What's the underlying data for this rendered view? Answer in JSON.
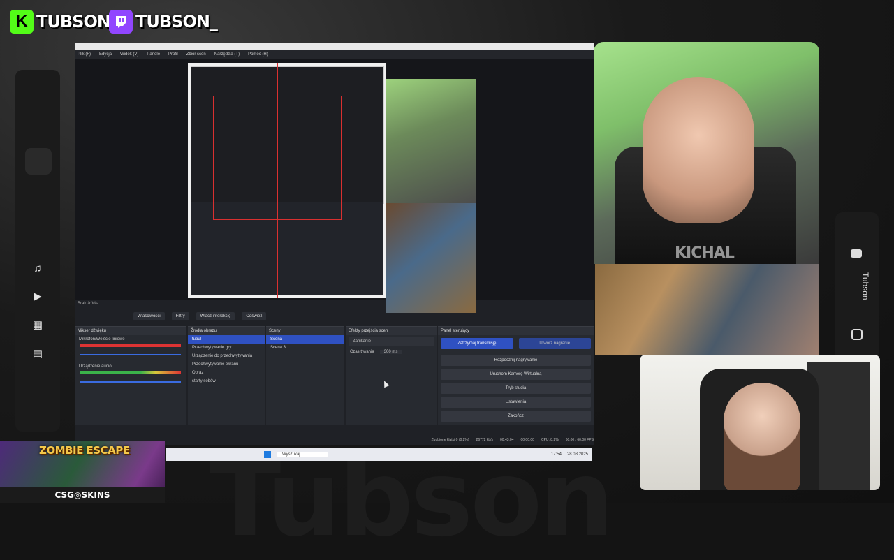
{
  "social": {
    "kick": {
      "icon": "kick-icon",
      "letter": "K",
      "handle": "TUBSON",
      "color": "#53fc18"
    },
    "twitch": {
      "icon": "twitch-icon",
      "handle": "TUBSON_",
      "color": "#9146ff"
    }
  },
  "background_text": "Tubson",
  "right_sidebar": {
    "label": "Tubson",
    "icons": [
      "youtube-icon",
      "instagram-icon"
    ]
  },
  "obs": {
    "menu": [
      "Plik (F)",
      "Edycja",
      "Widok (V)",
      "Panele",
      "Profil",
      "Zbiór scen",
      "Narzędzia (T)",
      "Pomoc (H)"
    ],
    "toolbar": [
      "Właściwości",
      "Filtry",
      "Włącz interakcję",
      "Odśwież"
    ],
    "source_name": "Brak źródła",
    "docks": {
      "mixer": {
        "title": "Mikser dźwięku",
        "channels": [
          "Mikrofon/Wejście liniowe",
          "Urządzenie audio"
        ]
      },
      "sources": {
        "title": "Źródła obrazu",
        "items": [
          "tubul",
          "Przechwytywanie gry",
          "Urządzenie do przechwytywania",
          "Przechwytywanie ekranu",
          "Obraz",
          "starty sobów"
        ]
      },
      "scenes": {
        "title": "Sceny",
        "items": [
          "Scena",
          "Scena 3"
        ]
      },
      "transitions": {
        "title": "Efekty przejścia scen",
        "selected": "Zanikanie",
        "duration_label": "Czas trwania",
        "duration": "300 ms"
      },
      "controls": {
        "title": "Panel sterujący",
        "buttons": [
          "Zatrzymaj transmisję",
          "Rozpocznij nagrywanie",
          "Uruchom Kamerę Wirtualną",
          "Tryb studia",
          "Ustawienia",
          "Zakończ"
        ],
        "secondary": "Utwórz nagranie"
      }
    },
    "status": [
      "Zgubione klatki 0 (0.2%)",
      "26772 kb/s",
      "00:43:04",
      "00:00:00",
      "CPU: 8.2%",
      "60.00 / 60.00 FPS"
    ]
  },
  "taskbar": {
    "search_placeholder": "Wyszukaj",
    "time": "17:54",
    "date": "28.08.2025"
  },
  "webcam_watermark": "KICHAL",
  "promo": {
    "title": "ZOMBIE ESCAPE",
    "brand": "CSG◎SKINS"
  }
}
